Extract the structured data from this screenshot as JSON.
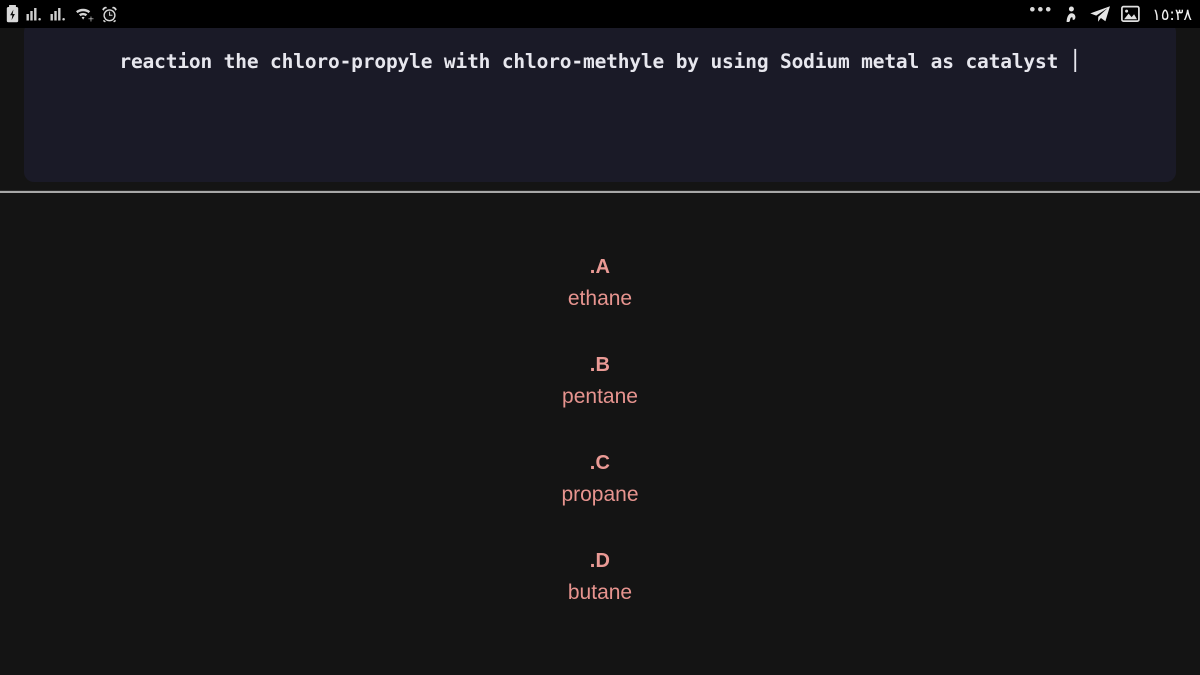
{
  "status_bar": {
    "time": "١٥:٣٨",
    "overflow_dots": "•••",
    "left_icons": [
      {
        "name": "battery-charging-icon"
      },
      {
        "name": "signal-bars-sim1-icon"
      },
      {
        "name": "signal-bars-sim2-icon"
      },
      {
        "name": "wifi-icon"
      },
      {
        "name": "alarm-clock-icon"
      }
    ],
    "right_icons": [
      {
        "name": "app-notification-icon"
      },
      {
        "name": "telegram-icon"
      },
      {
        "name": "gallery-image-icon"
      }
    ]
  },
  "question": {
    "clipped_top_line": "......  ......",
    "text": "reaction the chloro-propyle with chloro-methyle by using Sodium metal as catalyst ׀"
  },
  "options": [
    {
      "label": ".A",
      "text": "ethane"
    },
    {
      "label": ".B",
      "text": "pentane"
    },
    {
      "label": ".C",
      "text": "propane"
    },
    {
      "label": ".D",
      "text": "butane"
    }
  ],
  "colors": {
    "page_background": "#141414",
    "card_background": "#1a1a27",
    "question_text": "#e7e7ee",
    "option_label": "#ea9a95",
    "option_text": "#e7948f",
    "divider": "#a8a8a8",
    "status_bar_background": "#000000"
  }
}
